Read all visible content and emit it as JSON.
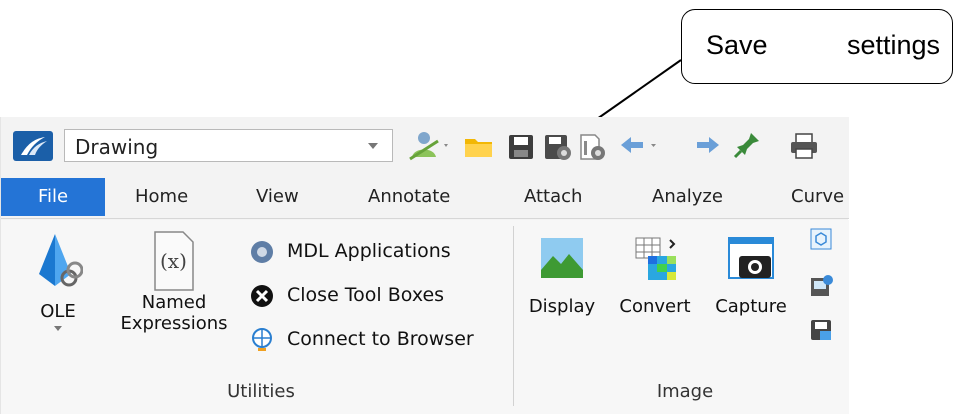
{
  "callout": {
    "word1": "Save",
    "word2": "settings"
  },
  "quick_access": {
    "workspace_combo": "Drawing",
    "buttons": [
      "user-icon",
      "folder-icon",
      "save-icon",
      "save-settings-icon",
      "settings-icon",
      "undo-icon",
      "redo-icon",
      "pin-icon",
      "print-icon"
    ]
  },
  "tabs": [
    "File",
    "Home",
    "View",
    "Annotate",
    "Attach",
    "Analyze",
    "Curve"
  ],
  "ribbon": {
    "utilities": {
      "label": "Utilities",
      "ole": "OLE",
      "named_expressions_line1": "Named",
      "named_expressions_line2": "Expressions",
      "mdl_applications": "MDL Applications",
      "close_tool_boxes": "Close Tool Boxes",
      "connect_to_browser": "Connect to Browser"
    },
    "image": {
      "label": "Image",
      "display": "Display",
      "convert": "Convert",
      "capture": "Capture"
    }
  },
  "colors": {
    "accent": "#2474d6",
    "ribbon_bg": "#f7f7f7"
  }
}
